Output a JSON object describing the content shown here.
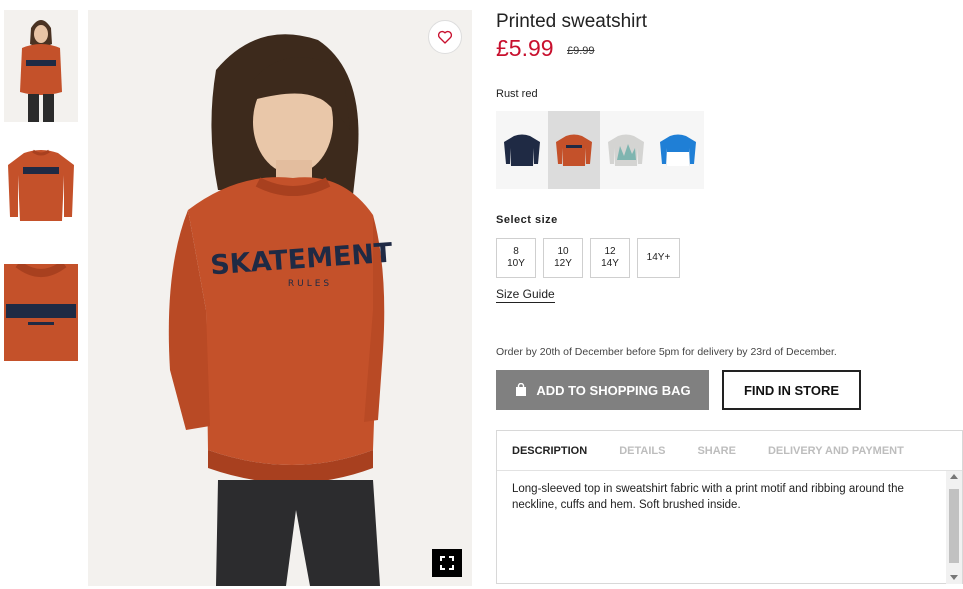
{
  "product": {
    "title": "Printed sweatshirt",
    "price": "£5.99",
    "old_price": "£9.99",
    "selected_color": "Rust red",
    "print_text": "SKATEMENT",
    "print_subtext": "RULES"
  },
  "colors": {
    "price_red": "#c8102e",
    "rust": "#c4512a",
    "navy": "#1f2a44",
    "grey": "#cfcfcf",
    "blue": "#1f7fd6"
  },
  "swatches": [
    {
      "name": "navy-sweatshirt",
      "color": "#1f2a44",
      "selected": false
    },
    {
      "name": "rust-sweatshirt",
      "color": "#c4512a",
      "selected": true
    },
    {
      "name": "grey-print-sweatshirt",
      "color": "#cfcfcf",
      "selected": false
    },
    {
      "name": "blue-white-sweatshirt",
      "color": "#1f7fd6",
      "selected": false
    }
  ],
  "size_section": {
    "label": "Select size",
    "sizes": [
      {
        "line1": "8",
        "line2": "10Y"
      },
      {
        "line1": "10",
        "line2": "12Y"
      },
      {
        "line1": "12",
        "line2": "14Y"
      },
      {
        "line1": "14Y+",
        "line2": ""
      }
    ],
    "guide": "Size Guide"
  },
  "delivery_note": "Order by 20th of December before 5pm for delivery by 23rd of December.",
  "buttons": {
    "add_to_bag": "ADD TO SHOPPING BAG",
    "find_in_store": "FIND IN STORE"
  },
  "info_tabs": [
    {
      "label": "DESCRIPTION",
      "active": true
    },
    {
      "label": "DETAILS",
      "active": false
    },
    {
      "label": "SHARE",
      "active": false
    },
    {
      "label": "DELIVERY AND PAYMENT",
      "active": false
    }
  ],
  "description": "Long-sleeved top in sweatshirt fabric with a print motif and ribbing around the neckline, cuffs and hem. Soft brushed inside.",
  "icons": {
    "wishlist": "heart-icon",
    "fullscreen": "fullscreen-icon",
    "bag": "shopping-bag-icon"
  }
}
